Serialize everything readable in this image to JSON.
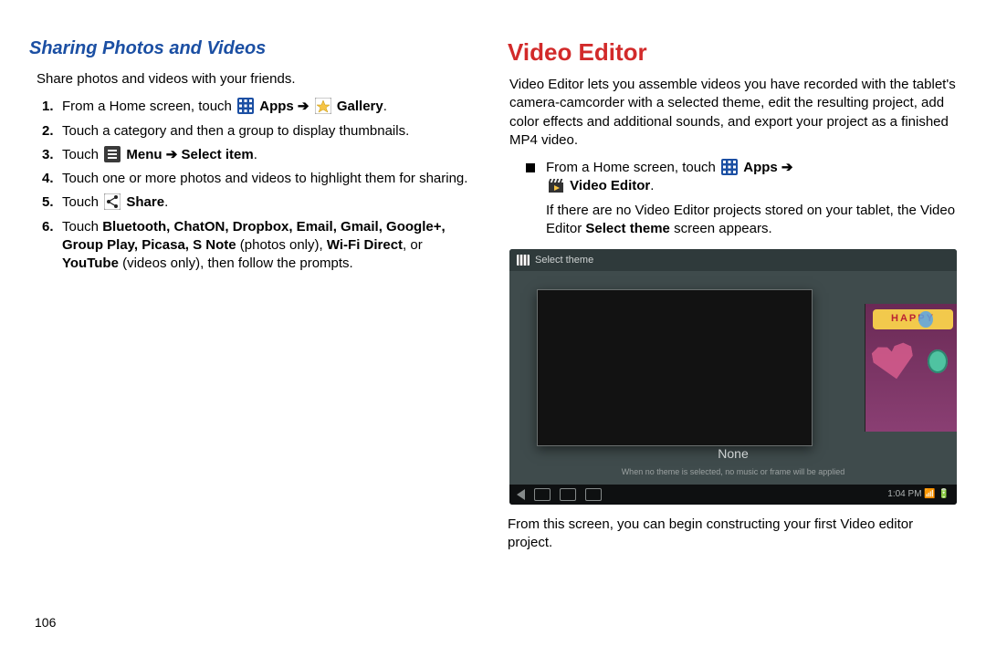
{
  "left": {
    "heading": "Sharing Photos and Videos",
    "intro": "Share photos and videos with your friends.",
    "steps": [
      {
        "n": "1.",
        "pre": "From a Home screen, touch ",
        "icon1": "apps-grid-icon",
        "mid1": " Apps",
        "arrow": " ➔ ",
        "icon2": "gallery-icon",
        "mid2": " Gallery",
        "post": "."
      },
      {
        "n": "2.",
        "plain": "Touch a category and then a group to display thumbnails."
      },
      {
        "n": "3.",
        "pre": "Touch ",
        "icon1": "menu-icon",
        "mid1": " Menu",
        "arrow": " ➔ ",
        "bold2": "Select item",
        "post": "."
      },
      {
        "n": "4.",
        "plain": "Touch one or more photos and videos to highlight them for sharing."
      },
      {
        "n": "5.",
        "pre": "Touch ",
        "icon1": "share-icon",
        "mid1": " Share",
        "post": "."
      },
      {
        "n": "6.",
        "complex_a": "Touch ",
        "complex_bold": "Bluetooth, ChatON, Dropbox, Email, Gmail, Google+, Group Play, Picasa, S Note",
        "complex_b": " (photos only), ",
        "complex_bold2": "Wi-Fi Direct",
        "complex_c": ", or ",
        "complex_bold3": "YouTube",
        "complex_d": " (videos only), then follow the prompts."
      }
    ],
    "page_number": "106"
  },
  "right": {
    "heading": "Video Editor",
    "intro": "Video Editor lets you assemble videos you have recorded with the tablet's camera-camcorder with a selected theme, edit the resulting project, add color effects and additional sounds, and export your project as a finished MP4 video.",
    "bullet_pre": "From a Home screen, touch ",
    "bullet_apps": " Apps",
    "bullet_arrow": " ➔",
    "bullet_editor": " Video Editor",
    "bullet_post": ".",
    "sub1_a": "If there are no Video Editor projects stored on your tablet, the Video Editor ",
    "sub1_bold": "Select theme",
    "sub1_b": " screen appears.",
    "tablet": {
      "topbar_label": "Select theme",
      "happy_label": "HAPPY",
      "none_label": "None",
      "hint": "When no theme is selected, no music or frame will be applied",
      "clock": "1:04 PM"
    },
    "below": "From this screen, you can begin constructing your first Video editor project."
  }
}
